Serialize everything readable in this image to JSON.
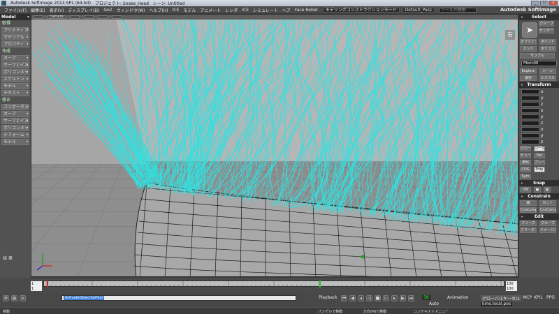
{
  "window": {
    "title": "Autodesk Softimage 2013 SP1 (64-bit)",
    "project": "プロジェクト: Snake_Head",
    "scene": "シーン: Untitled",
    "brand": "Autodesk Softimage",
    "controls": [
      "_",
      "□",
      "x"
    ]
  },
  "menu": {
    "items": [
      "ファイル(F)",
      "編集(E)",
      "表示(V)",
      "ディスプレイ(D)",
      "GoZ",
      "ウィンドウ(W)",
      "ヘルプ(H)",
      "ICE",
      "モデル",
      "アニメート",
      "レンダ",
      "ICE",
      "シミュレート",
      "ヘア",
      "Face Robot"
    ],
    "mode_dropdown": "モデリングコンストラクションモード",
    "pass_dropdown": "Default_Pass",
    "search_placeholder": "ツールの検索"
  },
  "left_panel": {
    "header": "Model",
    "sections": [
      {
        "title": "取得",
        "buttons": [
          "プリミティブ",
          "マテリアル",
          "プロパティ"
        ]
      },
      {
        "title": "作成",
        "buttons": [
          "カーブ",
          "サーフェイスメッシュ",
          "ポリゴンメッシュ",
          "スケルトン",
          "モデル",
          "テキスト"
        ]
      },
      {
        "title": "修正",
        "buttons": [
          "コンポーネント",
          "カーブ",
          "サーフェイスメッシュ",
          "ポリゴンメッシュ",
          "デフォーム",
          "モデル"
        ]
      }
    ],
    "bottom_label": "結 果"
  },
  "viewport": {
    "camera": "Camera",
    "tag": "右",
    "accent": "#33e0e0",
    "background": "#b0b0b0"
  },
  "right_panel": {
    "select_header": "Select",
    "select_buttons": [
      "グループ",
      "センター",
      "オブジェクト",
      "ポイント",
      "エッジ",
      "ポリゴン",
      "サンプル"
    ],
    "object_name": "Fibers98",
    "explore_buttons": [
      "Explore",
      "シーン",
      "選択",
      "ビジブル"
    ],
    "transform_header": "Transform",
    "transform_axes": [
      "x",
      "y",
      "z"
    ],
    "transform_modes": [
      "グローバル",
      "ローカル",
      "ビュー",
      "Par",
      "参照",
      "プレーン"
    ],
    "transform_bottom": [
      "COG",
      "Prop",
      "Sym",
      "ON"
    ],
    "snap_header": "Snap",
    "snap_on": "ON",
    "constrain_header": "Constrain",
    "constrain_buttons": [
      "親",
      "カット",
      "CnsComp",
      "CnsComp"
    ],
    "edit_header": "Edit",
    "edit_buttons": [
      "フリーズ",
      "グループ",
      "フリーズ M",
      "イメージエディタ"
    ]
  },
  "timeline": {
    "start": "1",
    "start2": "1",
    "end": "100",
    "end2": "100",
    "marker_frame": 60
  },
  "playbar": {
    "command": "ActivateObjectSelTool",
    "playback": "Playback",
    "frame": "58",
    "auto": "Auto",
    "animation": "Animation",
    "keying": "グローバルキーセル",
    "file": "kine.local.pos",
    "mcp_tabs": [
      "MCP",
      "KP/L",
      "PPG"
    ]
  },
  "status": {
    "left": "移動",
    "mid1": "パンデルで移動",
    "mid2": "方向(M)で移動",
    "right": "コンテキストメニュー"
  }
}
